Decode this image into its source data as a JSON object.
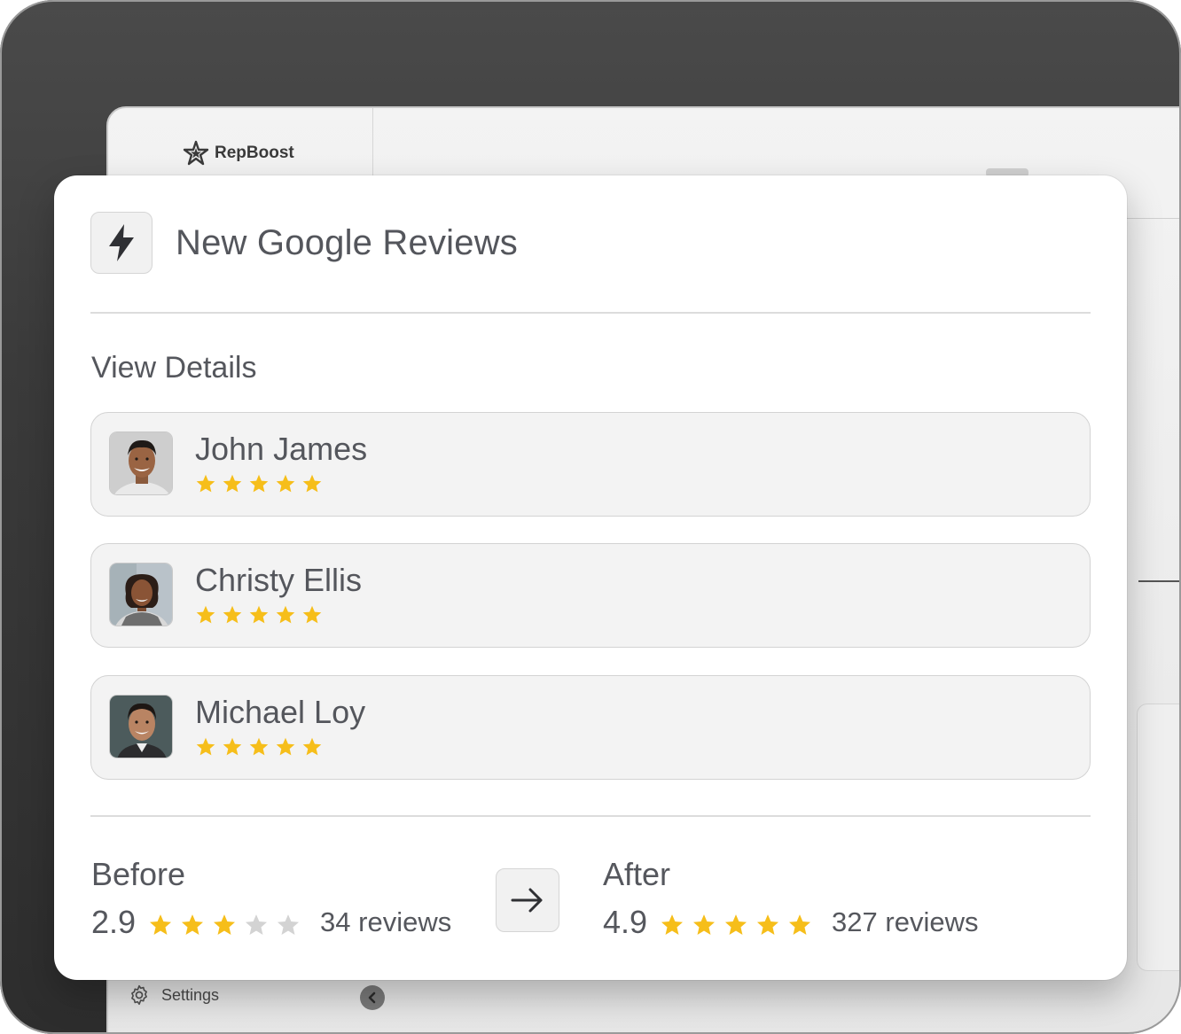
{
  "background_app": {
    "logo_text": "RepBoost",
    "settings_label": "Settings"
  },
  "card": {
    "title": "New Google Reviews",
    "header_icon": "lightning-bolt-icon",
    "section_title": "View Details",
    "reviews": [
      {
        "name": "John James",
        "rating": 5,
        "avatar": "man-portrait"
      },
      {
        "name": "Christy Ellis",
        "rating": 5,
        "avatar": "woman-portrait"
      },
      {
        "name": "Michael Loy",
        "rating": 5,
        "avatar": "man-portrait"
      }
    ],
    "before": {
      "label": "Before",
      "value": "2.9",
      "stars_filled": 3,
      "stars_total": 5,
      "count": "34 reviews"
    },
    "after": {
      "label": "After",
      "value": "4.9",
      "stars_filled": 5,
      "stars_total": 5,
      "count": "327 reviews"
    },
    "transition_icon": "arrow-right-icon"
  },
  "colors": {
    "star_filled": "#F6BE1A",
    "star_empty": "#D3D3D3",
    "text": "#55575D",
    "card_bg": "#FFFFFF",
    "row_bg": "#F3F3F3"
  }
}
